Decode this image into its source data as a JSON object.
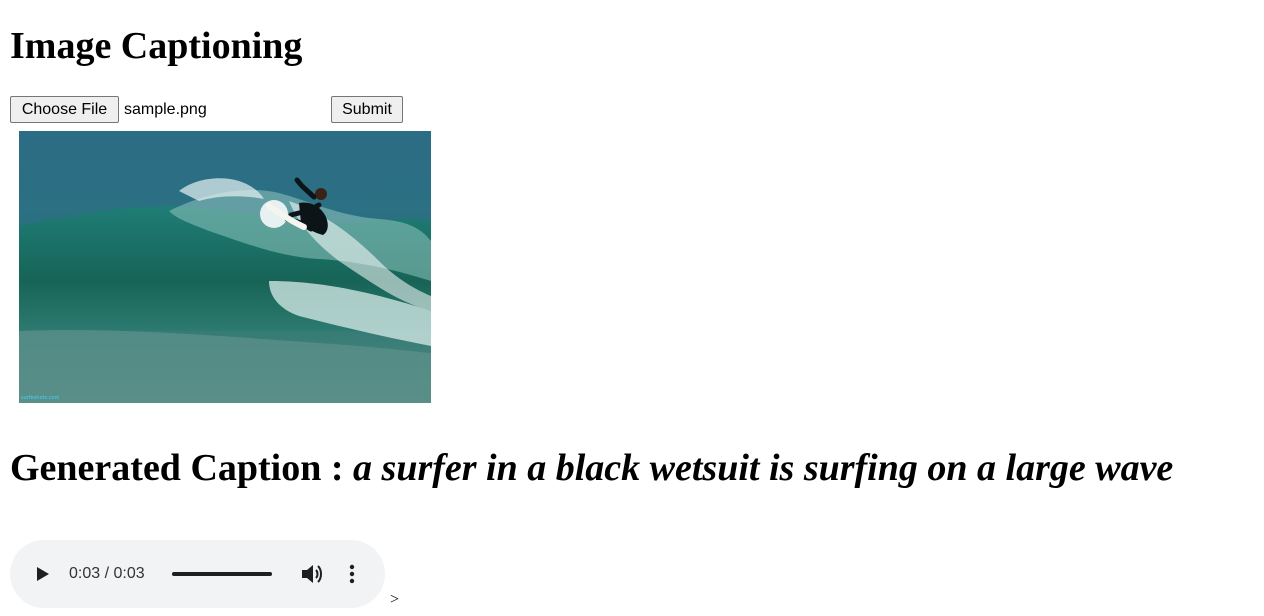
{
  "page": {
    "title": "Image Captioning"
  },
  "upload": {
    "choose_label": "Choose File",
    "file_name": "sample.png",
    "submit_label": "Submit"
  },
  "image": {
    "alt_subject": "surfer on a large wave",
    "watermark": "surfeshots.com"
  },
  "caption": {
    "label": "Generated Caption : ",
    "text": "a surfer in a black wetsuit is surfing on a large wave"
  },
  "audio": {
    "time": "0:03 / 0:03",
    "progress": 1.0,
    "icons": {
      "play": "play-icon",
      "volume": "volume-icon",
      "more": "more-options-icon"
    }
  },
  "stray_text": ">"
}
